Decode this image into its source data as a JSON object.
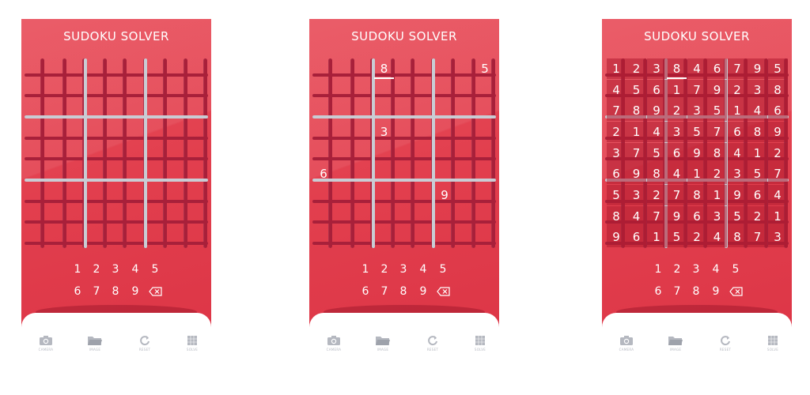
{
  "app": {
    "title": "SUDOKU SOLVER"
  },
  "screens": [
    {
      "id": "empty",
      "givens": [],
      "solved": []
    },
    {
      "id": "input",
      "givens": [
        {
          "r": 0,
          "c": 3,
          "v": "8",
          "highlight": true
        },
        {
          "r": 0,
          "c": 8,
          "v": "5"
        },
        {
          "r": 3,
          "c": 3,
          "v": "3"
        },
        {
          "r": 5,
          "c": 0,
          "v": "6"
        },
        {
          "r": 6,
          "c": 6,
          "v": "9"
        }
      ],
      "solved": []
    },
    {
      "id": "solved",
      "givens": [],
      "highlight": {
        "r": 0,
        "c": 3
      },
      "solved": [
        [
          "1",
          "2",
          "3",
          "8",
          "4",
          "6",
          "7",
          "9",
          "5"
        ],
        [
          "4",
          "5",
          "6",
          "1",
          "7",
          "9",
          "2",
          "3",
          "8"
        ],
        [
          "7",
          "8",
          "9",
          "2",
          "3",
          "5",
          "1",
          "4",
          "6"
        ],
        [
          "2",
          "1",
          "4",
          "3",
          "5",
          "7",
          "6",
          "8",
          "9"
        ],
        [
          "3",
          "7",
          "5",
          "6",
          "9",
          "8",
          "4",
          "1",
          "2"
        ],
        [
          "6",
          "9",
          "8",
          "4",
          "1",
          "2",
          "3",
          "5",
          "7"
        ],
        [
          "5",
          "3",
          "2",
          "7",
          "8",
          "1",
          "9",
          "6",
          "4"
        ],
        [
          "8",
          "4",
          "7",
          "9",
          "6",
          "3",
          "5",
          "2",
          "1"
        ],
        [
          "9",
          "6",
          "1",
          "5",
          "2",
          "4",
          "8",
          "7",
          "3"
        ]
      ]
    }
  ],
  "keypad": {
    "row1": [
      "1",
      "2",
      "3",
      "4",
      "5"
    ],
    "row2": [
      "6",
      "7",
      "8",
      "9"
    ],
    "backspace_icon": "backspace-icon"
  },
  "toolbar": [
    {
      "label": "CAMERA",
      "icon": "camera-icon"
    },
    {
      "label": "IMAGE",
      "icon": "folder-icon"
    },
    {
      "label": "RESET",
      "icon": "reset-icon"
    },
    {
      "label": "SOLVE",
      "icon": "solve-icon"
    }
  ],
  "colors": {
    "background": "#e23f4e",
    "grid_bar": "#a8203a",
    "box_line": "#c9ccd4",
    "text": "#ffffff",
    "toolbar_icon": "#b5b8c0"
  }
}
